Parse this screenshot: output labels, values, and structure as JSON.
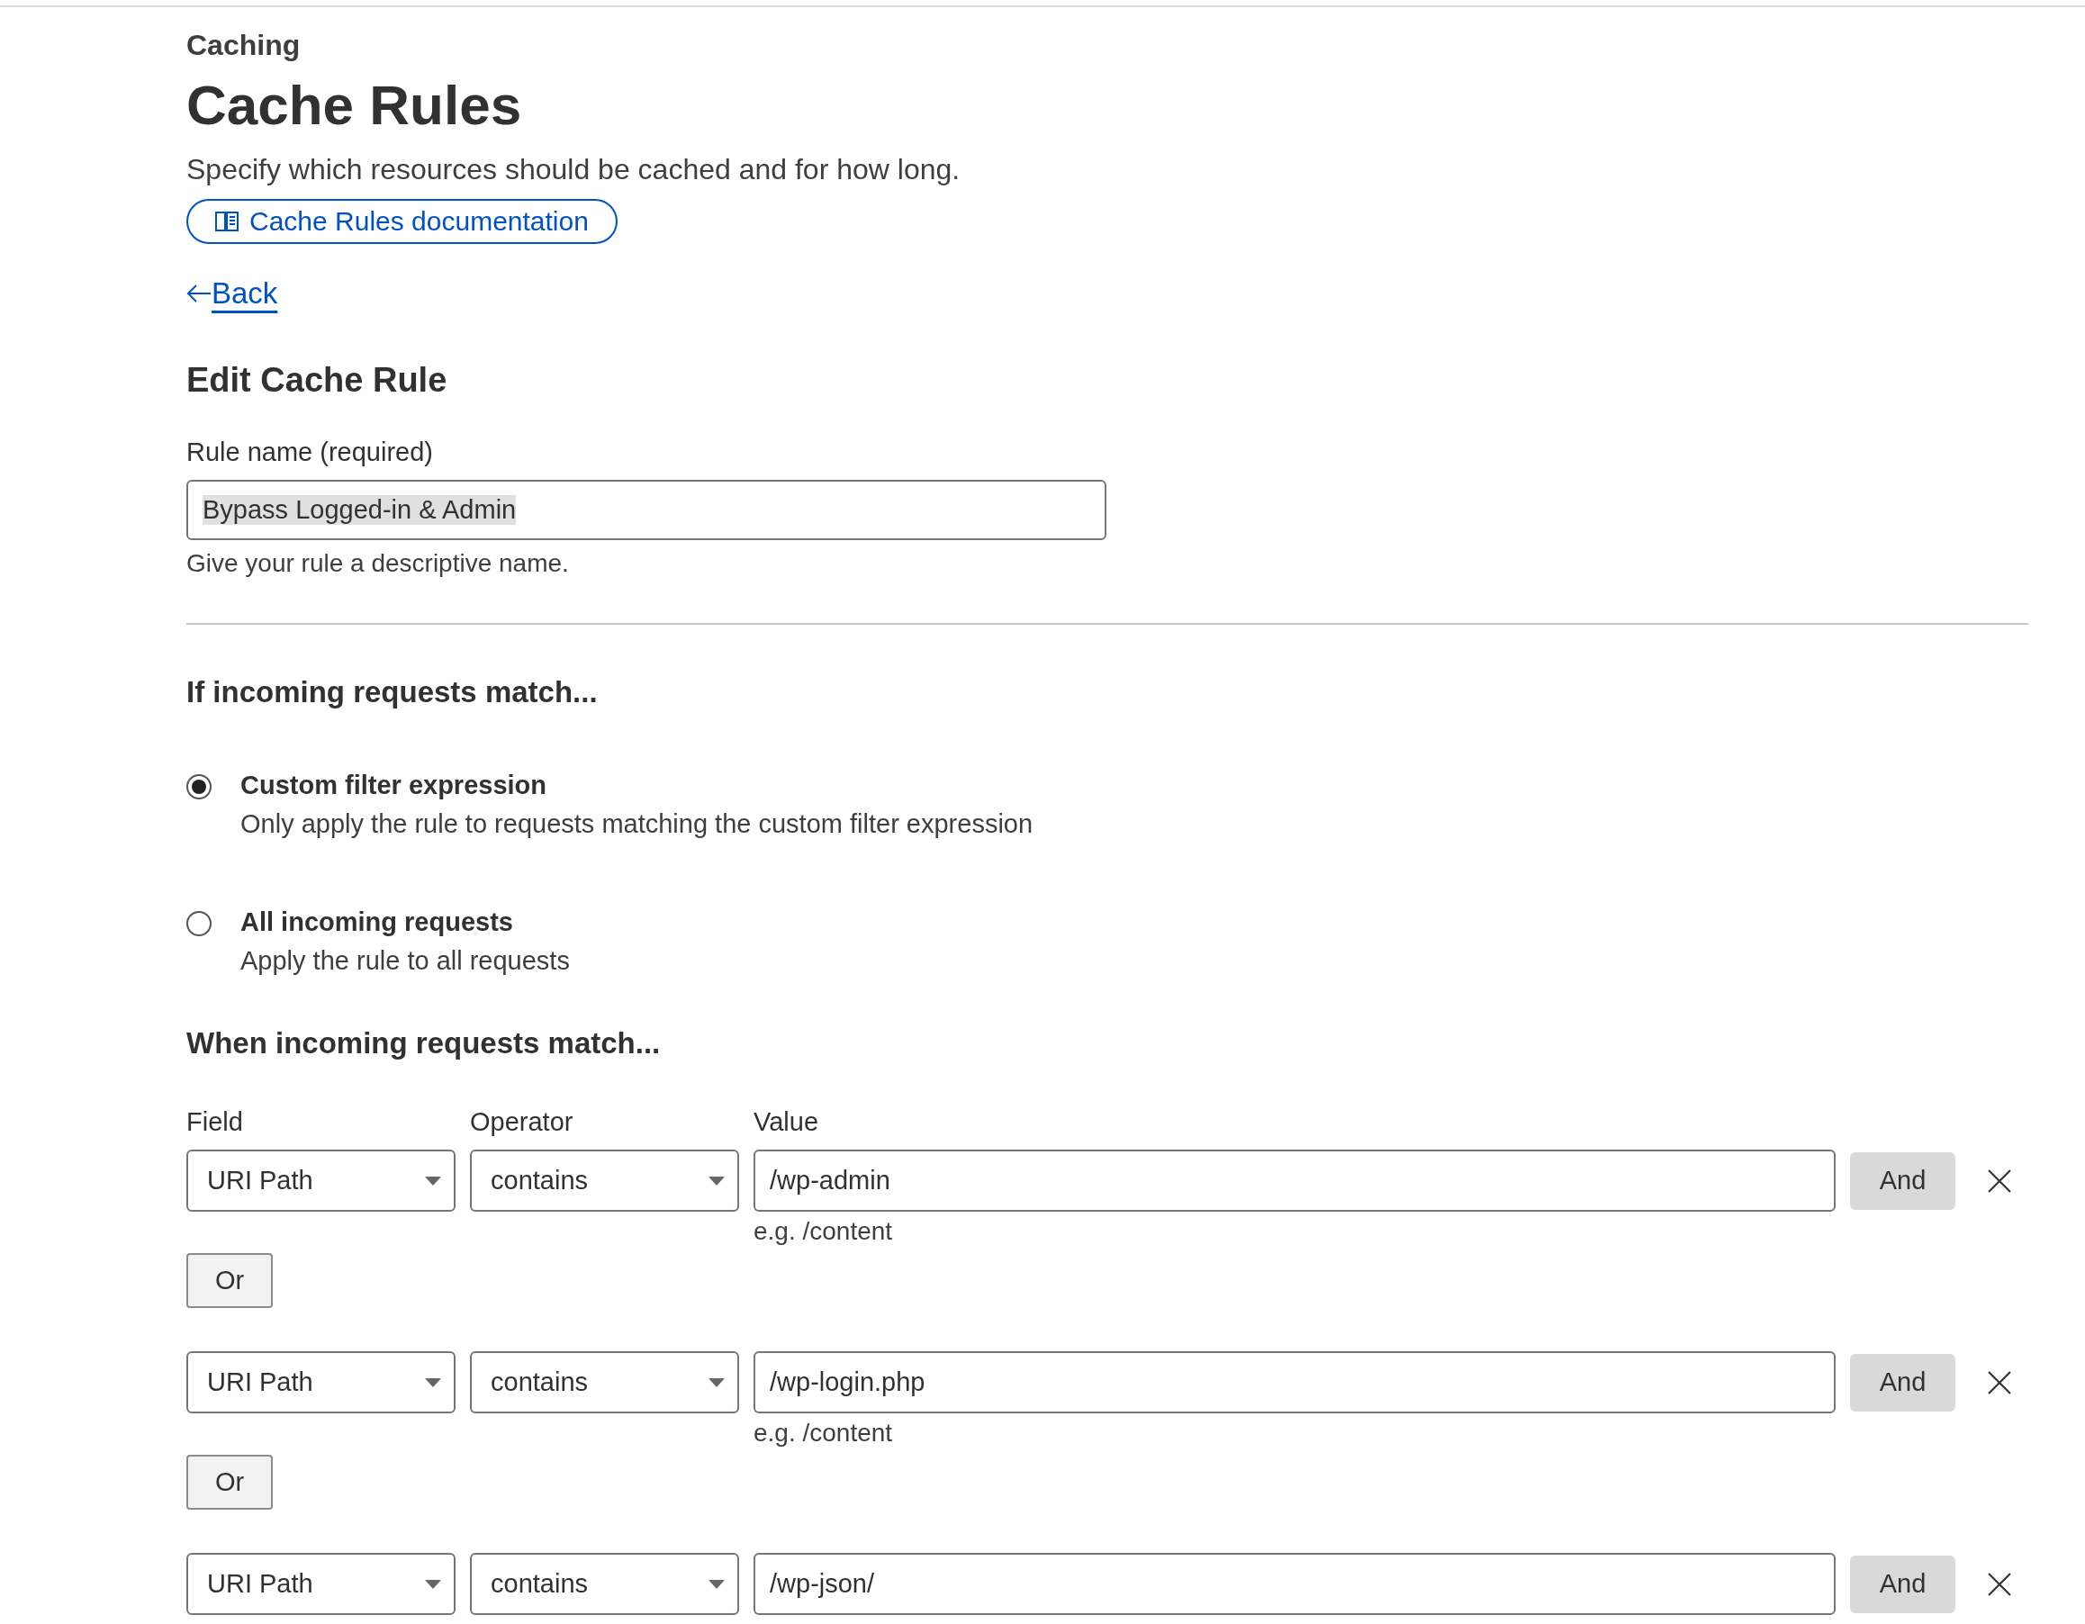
{
  "header": {
    "section": "Caching",
    "title": "Cache Rules",
    "description": "Specify which resources should be cached and for how long.",
    "doc_link": "Cache Rules documentation",
    "back": "Back"
  },
  "form": {
    "heading": "Edit Cache Rule",
    "rule_name": {
      "label": "Rule name (required)",
      "value": "Bypass Logged-in & Admin",
      "hint": "Give your rule a descriptive name."
    }
  },
  "match": {
    "heading": "If incoming requests match...",
    "options": [
      {
        "title": "Custom filter expression",
        "description": "Only apply the rule to requests matching the custom filter expression",
        "selected": true
      },
      {
        "title": "All incoming requests",
        "description": "Apply the rule to all requests",
        "selected": false
      }
    ]
  },
  "expression": {
    "heading": "When incoming requests match...",
    "columns": [
      "Field",
      "Operator",
      "Value"
    ],
    "conditions": [
      {
        "field": "URI Path",
        "operator": "contains",
        "value": "/wp-admin",
        "hint": "e.g. /content",
        "and": "And",
        "or": "Or"
      },
      {
        "field": "URI Path",
        "operator": "contains",
        "value": "/wp-login.php",
        "hint": "e.g. /content",
        "and": "And",
        "or": "Or"
      },
      {
        "field": "URI Path",
        "operator": "contains",
        "value": "/wp-json/",
        "and": "And"
      }
    ]
  }
}
